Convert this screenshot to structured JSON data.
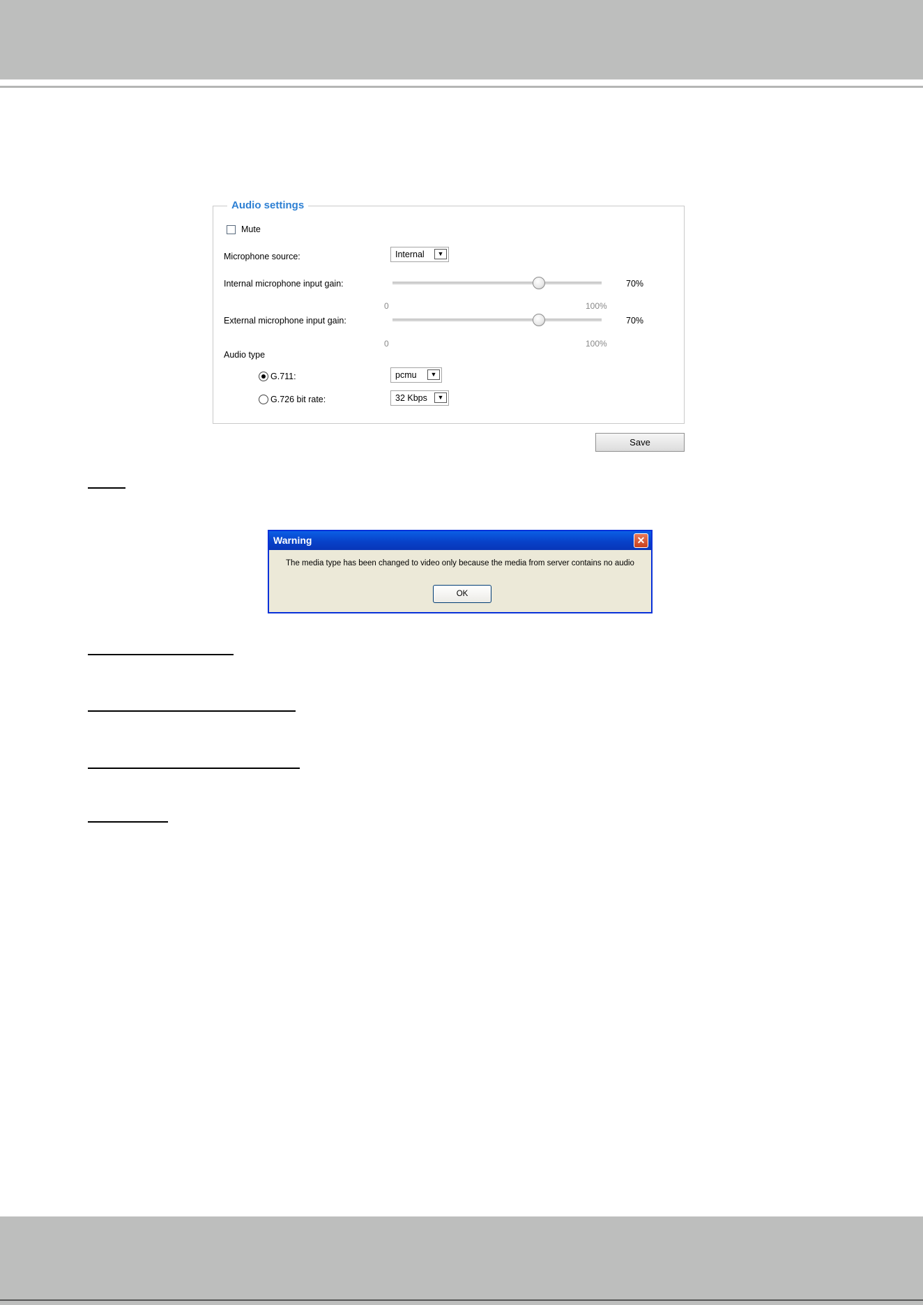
{
  "audio_settings": {
    "legend": "Audio settings",
    "mute_label": "Mute",
    "mute_checked": false,
    "mic_source_label": "Microphone source:",
    "mic_source_value": "Internal",
    "internal_gain_label": "Internal microphone input gain:",
    "internal_gain_value": "70%",
    "internal_gain_percent": 70,
    "external_gain_label": "External microphone input gain:",
    "external_gain_value": "70%",
    "external_gain_percent": 70,
    "scale_min": "0",
    "scale_max": "100%",
    "audio_type_label": "Audio type",
    "g711_label": "G.711:",
    "g711_selected": true,
    "g711_value": "pcmu",
    "g726_label": "G.726 bit rate:",
    "g726_selected": false,
    "g726_value": "32 Kbps",
    "save_label": "Save"
  },
  "dialog": {
    "title": "Warning",
    "close_glyph": "✕",
    "message": "The media type has been changed to video only because the media from server contains no audio",
    "ok_label": "OK"
  },
  "icons": {
    "dropdown": "chevron-down-icon",
    "close": "close-icon"
  }
}
